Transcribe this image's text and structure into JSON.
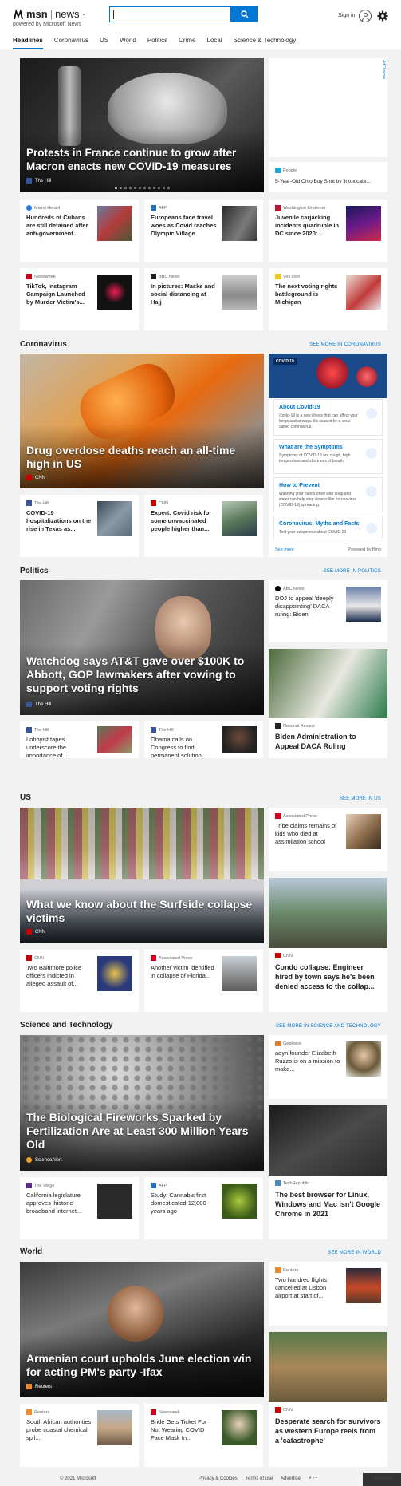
{
  "brand": {
    "logo": "msn",
    "section": "news",
    "powered": "powered by Microsoft News"
  },
  "header": {
    "signin": "Sign in",
    "search_placeholder": ""
  },
  "nav": [
    "Headlines",
    "Coronavirus",
    "US",
    "World",
    "Politics",
    "Crime",
    "Local",
    "Science & Technology"
  ],
  "top": {
    "hero": {
      "title": "Protests in France continue to grow after Macron enacts new COVID-19 measures",
      "source": "The Hill"
    },
    "ad_tag": "AdChoices",
    "side_card": {
      "source": "People",
      "title": "5-Year-Old Ohio Boy Shot by 'Intoxicate..."
    },
    "cards": [
      {
        "source": "Miami Herald",
        "title": "Hundreds of Cubans are still detained after anti-government..."
      },
      {
        "source": "AFP",
        "title": "Europeans face travel woes as Covid reaches Olympic Village"
      },
      {
        "source": "Washington Examiner",
        "title": "Juvenile carjacking incidents quadruple in DC since 2020:..."
      },
      {
        "source": "Newsweek",
        "title": "TikTok, Instagram Campaign Launched by Murder Victim's..."
      },
      {
        "source": "BBC News",
        "title": "In pictures: Masks and social distancing at Hajj"
      },
      {
        "source": "Vox.com",
        "title": "The next voting rights battleground is Michigan"
      }
    ]
  },
  "coronavirus": {
    "title": "Coronavirus",
    "see_more": "SEE MORE IN CORONAVIRUS",
    "hero": {
      "title": "Drug overdose deaths reach an all-time high in US",
      "source": "CNN"
    },
    "cards": [
      {
        "source": "The Hill",
        "title": "COVID-19 hospitalizations on the rise in Texas as..."
      },
      {
        "source": "CNN",
        "title": "Expert: Covid risk for some unvaccinated people higher than..."
      }
    ],
    "panel": {
      "tag": "COVID 19",
      "items": [
        {
          "h": "About Covid-19",
          "d": "Covid-19 is a new illness that can affect your lungs and airways. It's caused by a virus called coronavirus."
        },
        {
          "h": "What are the Symptoms",
          "d": "Symptoms of COVID-19 are cough, high temperature and shortness of breath."
        },
        {
          "h": "How to Prevent",
          "d": "Washing your hands often with soap and water can help stop viruses like coronavirus (COVID-19) spreading."
        },
        {
          "h": "Coronavirus: Myths and Facts",
          "d": "Test your awareness about COVID-19"
        }
      ],
      "see_more": "See more",
      "powered": "Powered by Bing"
    }
  },
  "politics": {
    "title": "Politics",
    "see_more": "SEE MORE IN POLITICS",
    "hero": {
      "title": "Watchdog says AT&T gave over $100K to Abbott, GOP lawmakers after vowing to support voting rights",
      "source": "The Hill"
    },
    "side_card": {
      "source": "ABC News",
      "title": "DOJ to appeal 'deeply disappointing' DACA ruling: Biden"
    },
    "big_card": {
      "source": "National Review",
      "title": "Biden Administration to Appeal DACA Ruling"
    },
    "cards": [
      {
        "source": "The Hill",
        "title": "Lobbyist tapes underscore the importance of..."
      },
      {
        "source": "The Hill",
        "title": "Obama calls on Congress to find permanent solution..."
      }
    ]
  },
  "us": {
    "title": "US",
    "see_more": "SEE MORE IN US",
    "hero": {
      "title": "What we know about the Surfside collapse victims",
      "source": "CNN"
    },
    "side_card": {
      "source": "Associated Press",
      "title": "Tribe claims remains of kids who died at assimilation school"
    },
    "big_card": {
      "source": "CNN",
      "title": "Condo collapse: Engineer hired by town says he's been denied access to the collap..."
    },
    "cards": [
      {
        "source": "CNN",
        "title": "Two Baltimore police officers indicted in alleged assault of..."
      },
      {
        "source": "Associated Press",
        "title": "Another victim identified in collapse of Florida..."
      }
    ]
  },
  "scitech": {
    "title": "Science and Technology",
    "see_more": "SEE MORE IN SCIENCE AND TECHNOLOGY",
    "hero": {
      "title": "The Biological Fireworks Sparked by Fertilization Are at Least 300 Million Years Old",
      "source": "ScienceAlert"
    },
    "side_card": {
      "source": "Geekwire",
      "title": "adyn founder Elizabeth Ruzzo is on a mission to make..."
    },
    "big_card": {
      "source": "TechRepublic",
      "title": "The best browser for Linux, Windows and Mac isn't Google Chrome in 2021"
    },
    "cards": [
      {
        "source": "The Verge",
        "title": "California legislature approves 'historic' broadband internet..."
      },
      {
        "source": "AFP",
        "title": "Study: Cannabis first domesticated 12,000 years ago"
      }
    ]
  },
  "world": {
    "title": "World",
    "see_more": "SEE MORE IN WORLD",
    "hero": {
      "title": "Armenian court upholds June election win for acting PM's party -Ifax",
      "source": "Reuters"
    },
    "side_card": {
      "source": "Reuters",
      "title": "Two hundred flights cancelled at Lisbon airport at start of..."
    },
    "big_card": {
      "source": "CNN",
      "title": "Desperate search for survivors as western Europe reels from a 'catastrophe'"
    },
    "cards": [
      {
        "source": "Reuters",
        "title": "South African authorities probe coastal chemical spil..."
      },
      {
        "source": "Newsweek",
        "title": "Bride Gets Ticket For Not Wearing COVID Face Mask In..."
      }
    ]
  },
  "footer": {
    "copyright": "© 2021 Microsoft",
    "privacy": "Privacy & Cookies",
    "terms": "Terms of use",
    "advertise": "Advertise",
    "more": "• • •",
    "feedback": "Feedback"
  },
  "colors": {
    "accent": "#0078d4",
    "page_bg": "#f2f2f2"
  }
}
